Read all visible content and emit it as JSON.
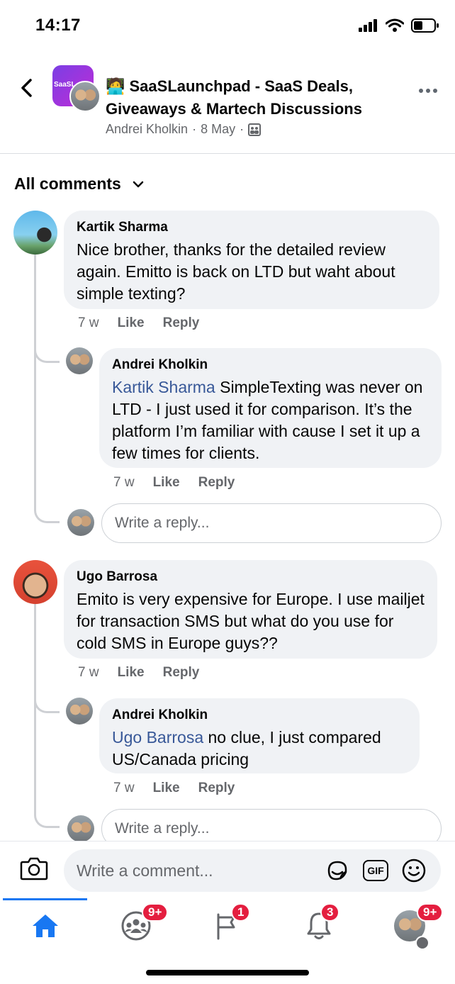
{
  "status": {
    "time": "14:17"
  },
  "header": {
    "group_avatar_text": "SaaSL",
    "title": "🧑‍💻 SaaSLaunchpad - SaaS Deals, Giveaways & Martech Discussions",
    "author": "Andrei Kholkin",
    "date": "8 May",
    "separator": "·"
  },
  "sort": {
    "label": "All comments"
  },
  "comments": [
    {
      "name": "Kartik Sharma",
      "text": "Nice brother, thanks for the detailed review again. Emitto is back on LTD but waht about simple texting?",
      "time": "7 w",
      "like": "Like",
      "reply": "Reply",
      "replies": [
        {
          "name": "Andrei Kholkin",
          "mention": "Kartik Sharma",
          "text": " SimpleTexting was never on LTD - I just used it for comparison. It’s the platform I’m familiar with cause I set it up a few times for clients.",
          "time": "7 w",
          "like": "Like",
          "reply": "Reply"
        }
      ],
      "reply_placeholder": "Write a reply..."
    },
    {
      "name": "Ugo Barrosa",
      "text": "Emito is very expensive for Europe. I use mailjet for transaction SMS but what do you use for cold SMS in Europe guys??",
      "time": "7 w",
      "like": "Like",
      "reply": "Reply",
      "replies": [
        {
          "name": "Andrei Kholkin",
          "mention": "Ugo Barrosa",
          "text": " no clue, I just compared US/Canada pricing",
          "time": "7 w",
          "like": "Like",
          "reply": "Reply"
        }
      ],
      "reply_placeholder": "Write a reply..."
    }
  ],
  "composer": {
    "placeholder": "Write a comment...",
    "gif_label": "GIF"
  },
  "tabs": [
    {
      "icon": "home-icon",
      "badge": ""
    },
    {
      "icon": "groups-icon",
      "badge": "9+"
    },
    {
      "icon": "pages-flag-icon",
      "badge": "1"
    },
    {
      "icon": "bell-icon",
      "badge": "3"
    },
    {
      "icon": "profile-menu-icon",
      "badge": "9+"
    }
  ],
  "colors": {
    "accent": "#1877f2",
    "mention": "#385898",
    "badge": "#e41e3f",
    "bubble": "#f0f2f5"
  }
}
